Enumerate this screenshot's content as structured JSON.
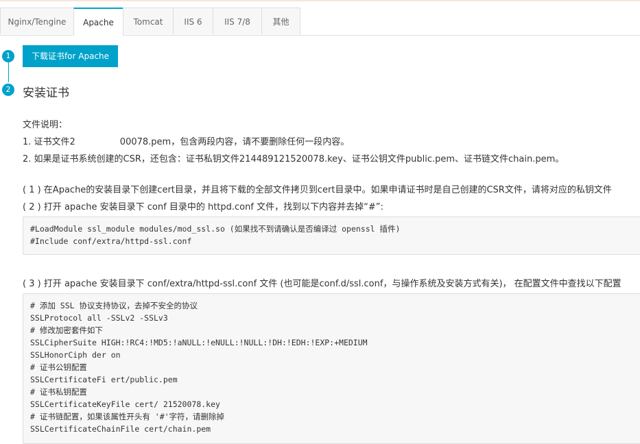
{
  "tabs": [
    "Nginx/Tengine",
    "Apache",
    "Tomcat",
    "IIS 6",
    "IIS 7/8",
    "其他"
  ],
  "steps": {
    "step1_number": "1",
    "step1_button": "下载证书for Apache",
    "step2_number": "2",
    "step2_title": "安装证书"
  },
  "desc": {
    "heading": "文件说明：",
    "line1": "1. 证书文件2     00078.pem，包含两段内容，请不要删除任何一段内容。",
    "line2": "2. 如果是证书系统创建的CSR，还包含：证书私钥文件214489121520078.key、证书公钥文件public.pem、证书链文件chain.pem。"
  },
  "instructions": {
    "p1": "( 1 ) 在Apache的安装目录下创建cert目录，并且将下载的全部文件拷贝到cert目录中。如果申请证书时是自己创建的CSR文件，请将对应的私钥文件",
    "p2": "( 2 ) 打开 apache 安装目录下 conf 目录中的 httpd.conf 文件，找到以下内容并去掉“#”:",
    "p3": "( 3 ) 打开 apache 安装目录下 conf/extra/httpd-ssl.conf 文件 (也可能是conf.d/ssl.conf，与操作系统及安装方式有关)， 在配置文件中查找以下配置"
  },
  "code1": [
    "#LoadModule ssl_module modules/mod_ssl.so (如果找不到请确认是否编译过 openssl 插件)",
    "#Include conf/extra/httpd-ssl.conf"
  ],
  "code2": [
    "# 添加 SSL 协议支持协议，去掉不安全的协议",
    "SSLProtocol all -SSLv2 -SSLv3",
    "# 修改加密套件如下",
    "SSLCipherSuite HIGH:!RC4:!MD5:!aNULL:!eNULL:!NULL:!DH:!EDH:!EXP:+MEDIUM",
    "SSLHonorCiph      der on",
    "# 证书公钥配置",
    "SSLCertificateFi      ert/public.pem",
    "# 证书私钥配置",
    "SSLCertificateKeyFile cert/       21520078.key",
    "# 证书链配置，如果该属性开头有 '#'字符，请删除掉",
    "SSLCertificateChainFile cert/chain.pem"
  ],
  "colors": {
    "accent": "#00a2ca"
  }
}
